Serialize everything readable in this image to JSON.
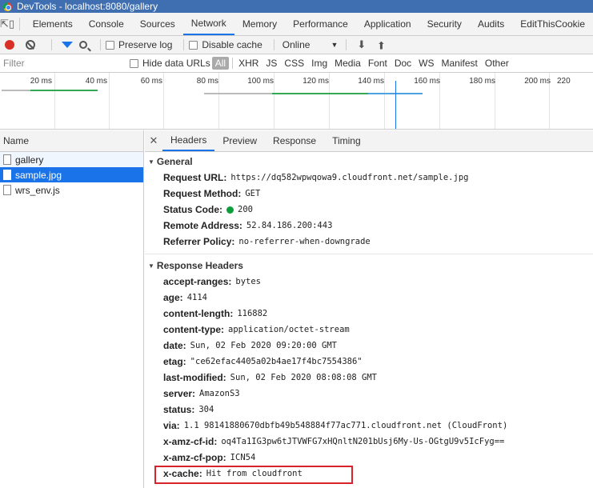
{
  "window": {
    "title": "DevTools - localhost:8080/gallery"
  },
  "main_tabs": [
    "Elements",
    "Console",
    "Sources",
    "Network",
    "Memory",
    "Performance",
    "Application",
    "Security",
    "Audits",
    "EditThisCookie"
  ],
  "active_main_tab": "Network",
  "toolbar": {
    "preserve_log": "Preserve log",
    "disable_cache": "Disable cache",
    "throttle": "Online"
  },
  "filterbar": {
    "placeholder": "Filter",
    "hide_data_urls": "Hide data URLs",
    "types": [
      "All",
      "XHR",
      "JS",
      "CSS",
      "Img",
      "Media",
      "Font",
      "Doc",
      "WS",
      "Manifest",
      "Other"
    ],
    "active_type": "All"
  },
  "timeline": {
    "ticks": [
      "20 ms",
      "40 ms",
      "60 ms",
      "80 ms",
      "100 ms",
      "120 ms",
      "140 ms",
      "160 ms",
      "180 ms",
      "200 ms",
      "220"
    ]
  },
  "requests": {
    "header": "Name",
    "items": [
      "gallery",
      "sample.jpg",
      "wrs_env.js"
    ],
    "selected": "sample.jpg"
  },
  "detail_tabs": [
    "Headers",
    "Preview",
    "Response",
    "Timing"
  ],
  "active_detail_tab": "Headers",
  "general": {
    "title": "General",
    "rows": [
      {
        "key": "Request URL:",
        "value": "https://dq582wpwqowa9.cloudfront.net/sample.jpg"
      },
      {
        "key": "Request Method:",
        "value": "GET"
      },
      {
        "key": "Status Code:",
        "value": "200"
      },
      {
        "key": "Remote Address:",
        "value": "52.84.186.200:443"
      },
      {
        "key": "Referrer Policy:",
        "value": "no-referrer-when-downgrade"
      }
    ]
  },
  "response_headers": {
    "title": "Response Headers",
    "rows": [
      {
        "key": "accept-ranges:",
        "value": "bytes"
      },
      {
        "key": "age:",
        "value": "4114"
      },
      {
        "key": "content-length:",
        "value": "116882"
      },
      {
        "key": "content-type:",
        "value": "application/octet-stream"
      },
      {
        "key": "date:",
        "value": "Sun, 02 Feb 2020 09:20:00 GMT"
      },
      {
        "key": "etag:",
        "value": "\"ce62efac4405a02b4ae17f4bc7554386\""
      },
      {
        "key": "last-modified:",
        "value": "Sun, 02 Feb 2020 08:08:08 GMT"
      },
      {
        "key": "server:",
        "value": "AmazonS3"
      },
      {
        "key": "status:",
        "value": "304"
      },
      {
        "key": "via:",
        "value": "1.1 98141880670dbfb49b548884f77ac771.cloudfront.net (CloudFront)"
      },
      {
        "key": "x-amz-cf-id:",
        "value": "oq4Ta1IG3pw6tJTVWFG7xHQnltN201bUsj6My-Us-OGtgU9v5IcFyg=="
      },
      {
        "key": "x-amz-cf-pop:",
        "value": "ICN54"
      },
      {
        "key": "x-cache:",
        "value": "Hit from cloudfront"
      }
    ]
  },
  "colors": {
    "accent": "#1a73e8",
    "status_ok": "#0a9f3a",
    "highlight_box": "#d8232a"
  }
}
